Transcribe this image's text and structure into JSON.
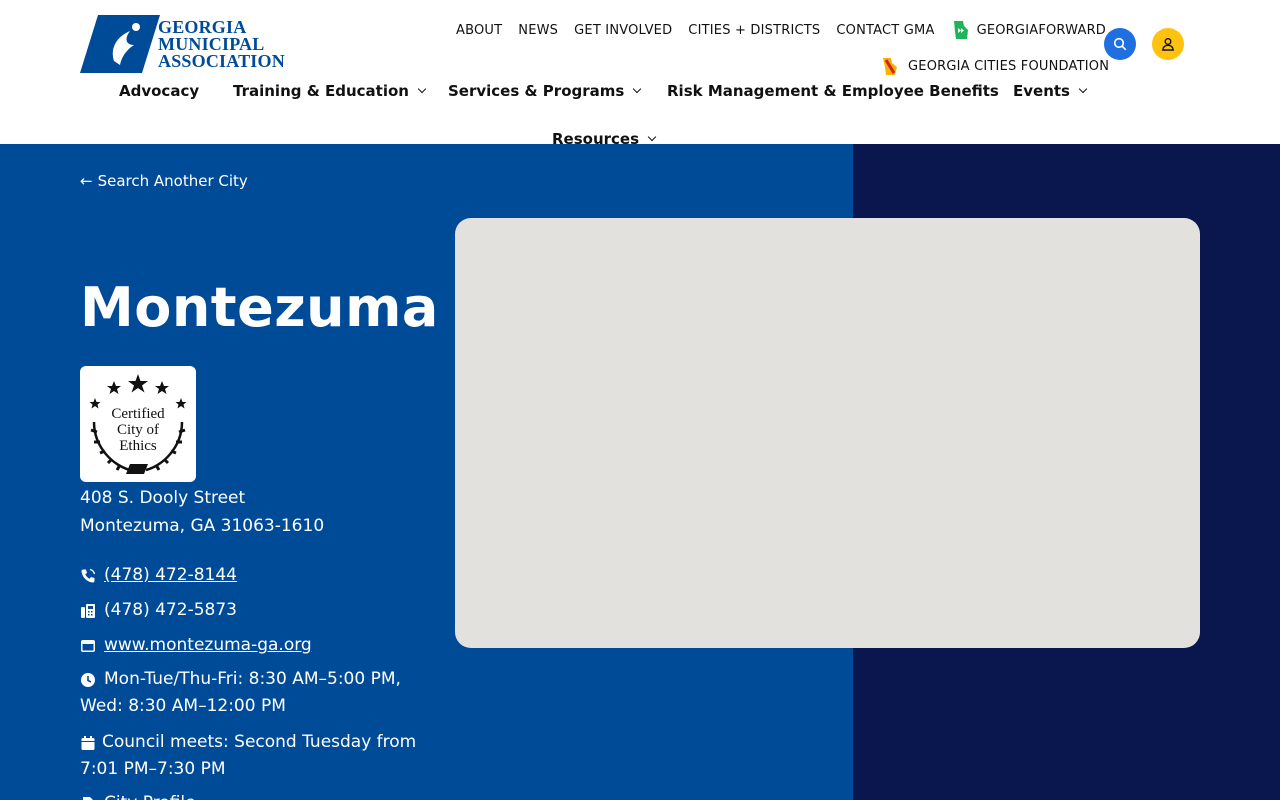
{
  "logo": {
    "line1": "GEORGIA",
    "line2": "MUNICIPAL",
    "line3": "ASSOCIATION"
  },
  "utility_nav": {
    "about": "ABOUT",
    "news": "NEWS",
    "get_involved": "GET INVOLVED",
    "cities_districts": "CITIES + DISTRICTS",
    "contact": "CONTACT GMA",
    "georgia_forward": "GEORGIAFORWARD",
    "cities_foundation": "GEORGIA CITIES FOUNDATION"
  },
  "main_nav": {
    "advocacy": "Advocacy",
    "training": "Training & Education",
    "services": "Services & Programs",
    "risk": "Risk Management & Employee Benefits",
    "events": "Events",
    "resources": "Resources"
  },
  "page": {
    "back_link": "Search Another City",
    "city_name": "Montezuma",
    "seal": {
      "line1": "Certified",
      "line2": "City of",
      "line3": "Ethics"
    },
    "address_line1": "408 S. Dooly Street",
    "address_line2": "Montezuma, GA 31063-1610",
    "phone": "(478) 472-8144",
    "fax": "(478) 472-5873",
    "website": "www.montezuma-ga.org",
    "hours_line1": "Mon-Tue/Thu-Fri: 8:30 AM–5:00 PM,",
    "hours_line2": "Wed: 8:30 AM–12:00 PM",
    "council_line1": "Council meets: Second Tuesday from",
    "council_line2": "7:01 PM–7:30 PM",
    "profile": "City Profile"
  },
  "colors": {
    "brand_blue": "#004b98",
    "navy": "#0a174e",
    "search_button": "#1f6fe0",
    "account_button": "#ffc20e",
    "map_background": "#e3e1de"
  }
}
